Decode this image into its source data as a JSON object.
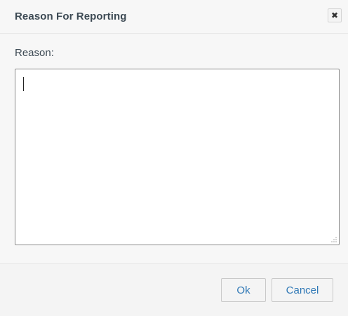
{
  "dialog": {
    "title": "Reason For Reporting",
    "close_icon": "close-icon"
  },
  "form": {
    "reason_label": "Reason:",
    "reason_value": ""
  },
  "footer": {
    "ok_label": "Ok",
    "cancel_label": "Cancel"
  },
  "colors": {
    "title_text": "#3d4a54",
    "button_text": "#2f78b6",
    "background": "#f4f4f4"
  }
}
